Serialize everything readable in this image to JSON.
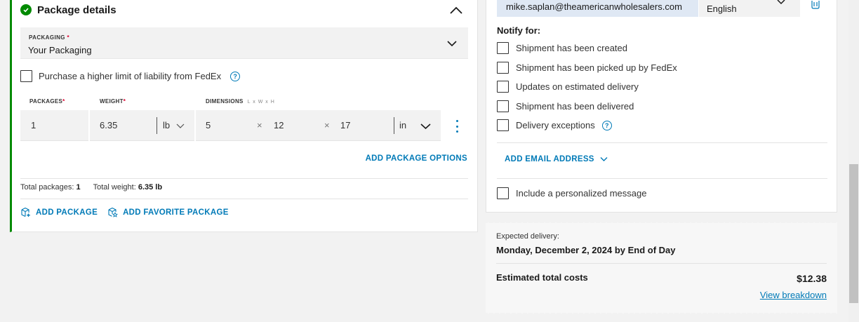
{
  "package_details": {
    "title": "Package details",
    "packaging_label": "PACKAGING",
    "required_mark": "*",
    "packaging_value": "Your Packaging",
    "liability_text": "Purchase a higher limit of liability from FedEx",
    "help_glyph": "?",
    "columns": {
      "packages": "PACKAGES",
      "weight": "WEIGHT",
      "dimensions": "DIMENSIONS",
      "dimensions_hint": "L x W x H"
    },
    "row": {
      "packages": "1",
      "weight": "6.35",
      "weight_unit": "lb",
      "length": "5",
      "width": "12",
      "height": "17",
      "dim_unit": "in",
      "times": "×"
    },
    "add_package_options": "ADD PACKAGE OPTIONS",
    "totals": {
      "packages_label": "Total packages:",
      "packages_value": "1",
      "weight_label": "Total weight:",
      "weight_value": "6.35 lb"
    },
    "add_package": "ADD PACKAGE",
    "add_favorite_package": "ADD FAVORITE PACKAGE"
  },
  "notifications": {
    "email": "mike.saplan@theamericanwholesalers.com",
    "language": "English",
    "notify_for": "Notify for:",
    "options": [
      "Shipment has been created",
      "Shipment has been picked up by FedEx",
      "Updates on estimated delivery",
      "Shipment has been delivered",
      "Delivery exceptions"
    ],
    "add_email": "ADD EMAIL ADDRESS",
    "personal_message": "Include a personalized message"
  },
  "summary": {
    "expected_label": "Expected delivery:",
    "expected_date": "Monday, December 2, 2024 by End of Day",
    "estimated_label": "Estimated total costs",
    "estimated_value": "$12.38",
    "view_breakdown": "View breakdown"
  },
  "colors": {
    "accent_green": "#008a00",
    "link_blue": "#007ab7",
    "required_red": "#de002e"
  }
}
